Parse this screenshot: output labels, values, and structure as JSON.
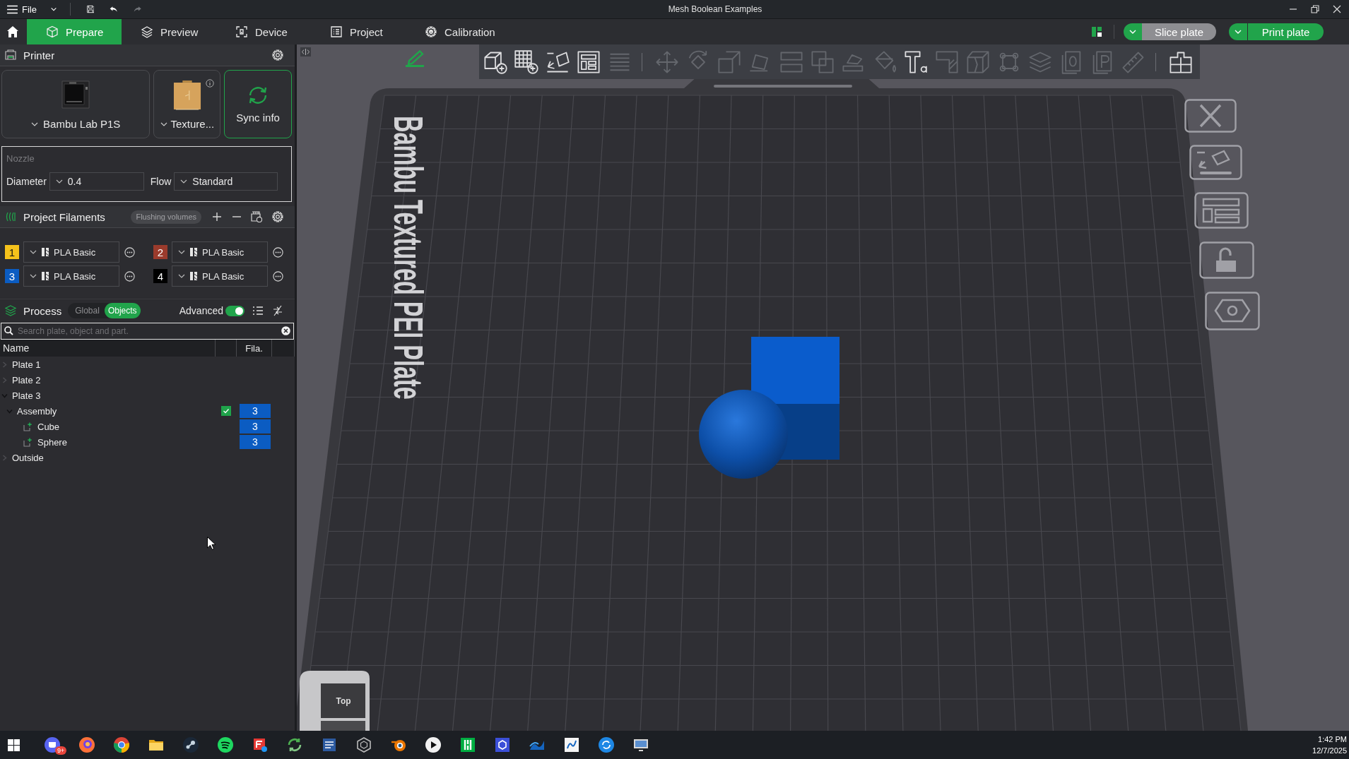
{
  "title_bar": {
    "menu_label": "File",
    "title": "Mesh Boolean Examples",
    "history": [
      {
        "kind": "undo",
        "disabled": false
      },
      {
        "kind": "redo",
        "disabled": true
      }
    ]
  },
  "tabs": [
    {
      "kind": "prepare",
      "label": "Prepare",
      "selected": true
    },
    {
      "kind": "preview",
      "label": "Preview",
      "selected": false
    },
    {
      "kind": "device",
      "label": "Device",
      "selected": false
    },
    {
      "kind": "project",
      "label": "Project",
      "selected": false
    },
    {
      "kind": "calibration",
      "label": "Calibration",
      "selected": false
    }
  ],
  "actions": {
    "slice": "Slice plate",
    "print": "Print plate"
  },
  "printer": {
    "title": "Printer",
    "model": "Bambu Lab P1S",
    "plate_type": "Texture...",
    "sync": "Sync info"
  },
  "nozzle": {
    "title": "Nozzle",
    "diameter_label": "Diameter",
    "diameter": "0.4",
    "flow_label": "Flow",
    "flow": "Standard"
  },
  "filaments": {
    "title": "Project Filaments",
    "flushing": "Flushing volumes",
    "items": [
      {
        "number": "1",
        "color": "#f5c21b",
        "name": "PLA Basic"
      },
      {
        "number": "2",
        "color": "#9a3b2c",
        "name": "PLA Basic"
      },
      {
        "number": "3",
        "color": "#0b5cc2",
        "name": "PLA Basic"
      },
      {
        "number": "4",
        "color": "#000000",
        "name": "PLA Basic"
      }
    ]
  },
  "process": {
    "title": "Process",
    "scopes": [
      {
        "label": "Global",
        "selected": false
      },
      {
        "label": "Objects",
        "selected": true
      }
    ],
    "advanced": {
      "label": "Advanced",
      "on": true
    }
  },
  "object_list": {
    "search_placeholder": "Search plate, object and part.",
    "columns": {
      "name": "Name",
      "filament": "Fila."
    },
    "rows": [
      {
        "kind": "plate",
        "name": "Plate 1",
        "expanded": false
      },
      {
        "kind": "plate",
        "name": "Plate 2",
        "expanded": false
      },
      {
        "kind": "plate",
        "name": "Plate 3",
        "expanded": true,
        "children": [
          {
            "kind": "object",
            "name": "Assembly",
            "expanded": true,
            "checked": true,
            "filament": "3",
            "color": "#0b5cc2",
            "children": [
              {
                "kind": "part",
                "name": "Cube",
                "filament": "3",
                "color": "#0b5cc2"
              },
              {
                "kind": "part",
                "name": "Sphere",
                "filament": "3",
                "color": "#0b5cc2"
              }
            ]
          }
        ]
      },
      {
        "kind": "plate",
        "name": "Outside",
        "expanded": false
      }
    ]
  },
  "viewport": {
    "plate_label": "Bambu Textured PEI Plate",
    "plate_locked": false,
    "view_cube_face": "Top",
    "toolbar": [
      [
        {
          "kind": "add-object",
          "disabled": false
        },
        {
          "kind": "add-plate",
          "disabled": false
        },
        {
          "kind": "auto-orient",
          "disabled": false
        },
        {
          "kind": "arrange",
          "disabled": false
        },
        {
          "kind": "split",
          "disabled": true
        }
      ],
      [
        {
          "kind": "move",
          "disabled": true
        },
        {
          "kind": "rotate",
          "disabled": true
        },
        {
          "kind": "scale",
          "disabled": true
        },
        {
          "kind": "lay-on-face",
          "disabled": true
        },
        {
          "kind": "cut",
          "disabled": true
        },
        {
          "kind": "boolean",
          "disabled": true
        },
        {
          "kind": "support-paint",
          "disabled": true
        },
        {
          "kind": "color-paint",
          "disabled": true
        },
        {
          "kind": "text",
          "disabled": false
        },
        {
          "kind": "seam",
          "disabled": true
        },
        {
          "kind": "crack",
          "disabled": true
        },
        {
          "kind": "fuzzy",
          "disabled": true
        },
        {
          "kind": "layers",
          "disabled": true
        },
        {
          "kind": "zero",
          "disabled": true
        },
        {
          "kind": "p",
          "disabled": true
        },
        {
          "kind": "measure",
          "disabled": true
        }
      ],
      [
        {
          "kind": "assembly",
          "disabled": false
        }
      ]
    ]
  },
  "taskbar": {
    "badge": "9+",
    "time": "1:42 PM",
    "date": "12/7/2025"
  }
}
